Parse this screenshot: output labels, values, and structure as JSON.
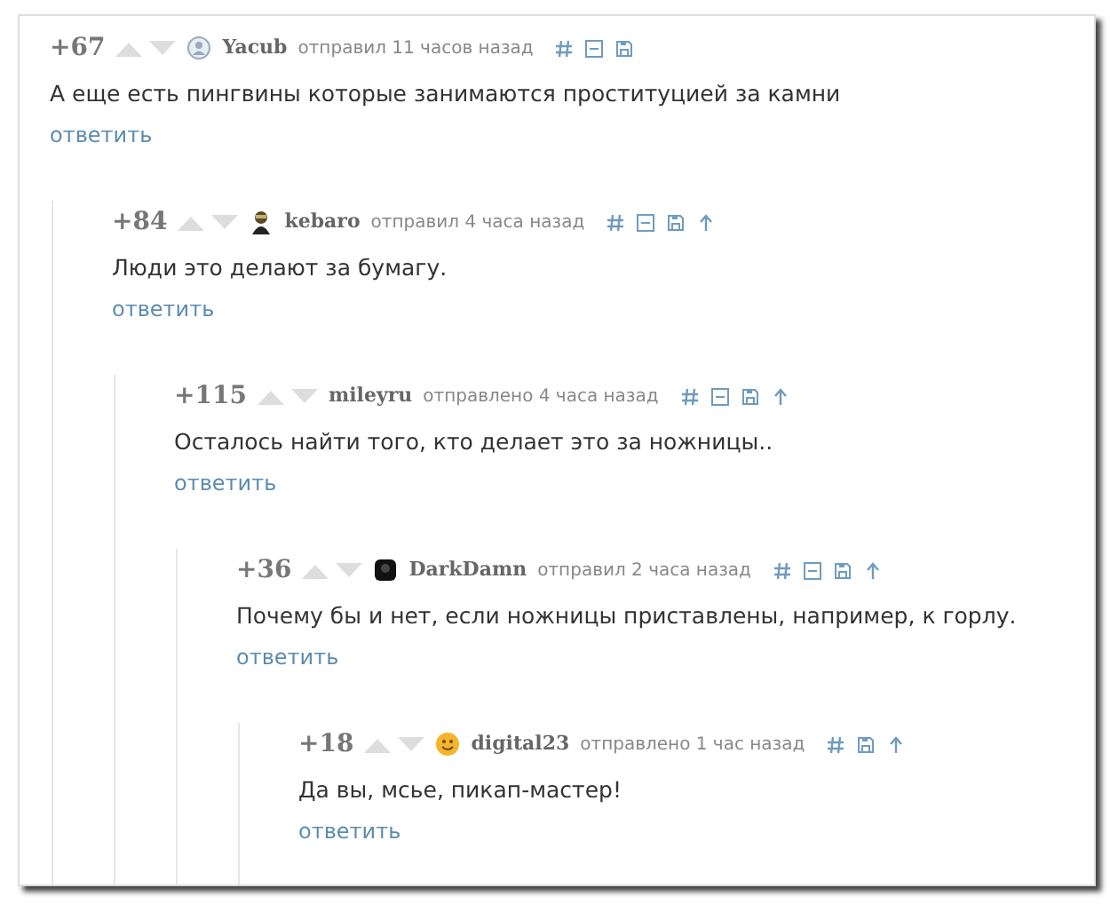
{
  "comments": [
    {
      "score": "+67",
      "avatar": {
        "kind": "default"
      },
      "user": "Yacub",
      "meta": "отправил 11 часов назад",
      "tools": [
        {
          "kind": "hash"
        },
        {
          "kind": "collapse"
        },
        {
          "kind": "save"
        }
      ],
      "text": "А еще есть пингвины которые занимаются проституцией за камни",
      "reply": "ответить",
      "children": [
        {
          "score": "+84",
          "avatar": {
            "kind": "photo"
          },
          "user": "kebaro",
          "meta": "отправил 4 часа назад",
          "tools": [
            {
              "kind": "hash"
            },
            {
              "kind": "collapse"
            },
            {
              "kind": "save"
            },
            {
              "kind": "parent"
            }
          ],
          "text": "Люди это делают за бумагу.",
          "reply": "ответить",
          "children": [
            {
              "score": "+115",
              "user": "mileyru",
              "meta": "отправлено 4 часа назад",
              "tools": [
                {
                  "kind": "hash"
                },
                {
                  "kind": "collapse"
                },
                {
                  "kind": "save"
                },
                {
                  "kind": "parent"
                }
              ],
              "text": "Осталось найти того, кто делает это за ножницы..",
              "reply": "ответить",
              "children": [
                {
                  "score": "+36",
                  "avatar": {
                    "kind": "dark"
                  },
                  "user": "DarkDamn",
                  "meta": "отправил 2 часа назад",
                  "tools": [
                    {
                      "kind": "hash"
                    },
                    {
                      "kind": "collapse"
                    },
                    {
                      "kind": "save"
                    },
                    {
                      "kind": "parent"
                    }
                  ],
                  "text": "Почему бы и нет, если ножницы приставлены, например, к горлу.",
                  "reply": "ответить",
                  "children": [
                    {
                      "score": "+18",
                      "avatar": {
                        "kind": "smiley"
                      },
                      "user": "digital23",
                      "meta": "отправлено 1 час назад",
                      "tools": [
                        {
                          "kind": "hash"
                        },
                        {
                          "kind": "save"
                        },
                        {
                          "kind": "parent"
                        }
                      ],
                      "text": "Да вы, мсье, пикап-мастер!",
                      "reply": "ответить"
                    }
                  ]
                }
              ]
            }
          ]
        }
      ]
    }
  ]
}
